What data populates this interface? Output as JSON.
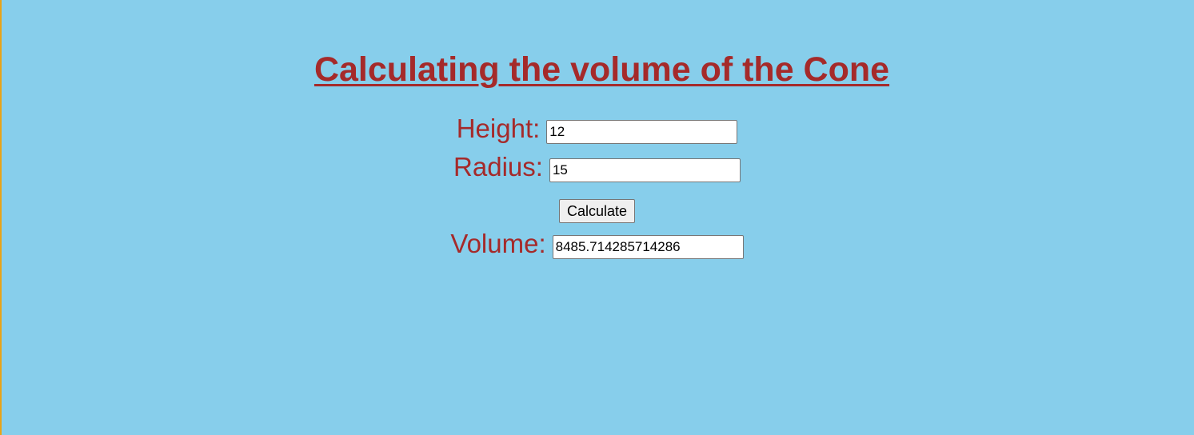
{
  "page": {
    "title": "Calculating the volume of the Cone"
  },
  "form": {
    "height": {
      "label": "Height:",
      "value": "12"
    },
    "radius": {
      "label": "Radius:",
      "value": "15"
    },
    "calculate_label": "Calculate",
    "volume": {
      "label": "Volume:",
      "value": "8485.714285714286"
    }
  },
  "colors": {
    "background": "#87CEEB",
    "text": "#A52A2A",
    "left_border": "#E8A317"
  }
}
